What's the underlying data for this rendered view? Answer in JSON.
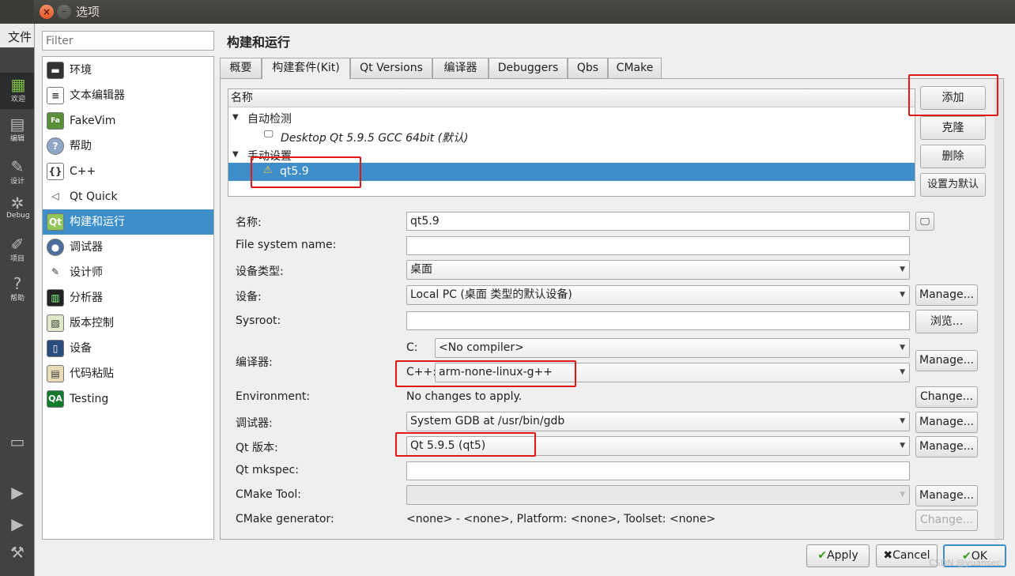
{
  "background": {
    "menu_file": "文件",
    "modes": [
      {
        "label": "欢迎",
        "icon": "grid-icon"
      },
      {
        "label": "编辑",
        "icon": "edit-icon"
      },
      {
        "label": "设计",
        "icon": "design-icon"
      },
      {
        "label": "Debug",
        "icon": "bug-icon"
      },
      {
        "label": "项目",
        "icon": "wrench-icon"
      },
      {
        "label": "帮助",
        "icon": "help-icon"
      }
    ]
  },
  "dialog": {
    "title": "选项",
    "filter_placeholder": "Filter",
    "categories": [
      {
        "label": "环境",
        "icon": "monitor-icon"
      },
      {
        "label": "文本编辑器",
        "icon": "text-editor-icon"
      },
      {
        "label": "FakeVim",
        "icon": "fakevim-icon"
      },
      {
        "label": "帮助",
        "icon": "help-icon"
      },
      {
        "label": "C++",
        "icon": "braces-icon"
      },
      {
        "label": "Qt Quick",
        "icon": "qtquick-icon"
      },
      {
        "label": "构建和运行",
        "icon": "qt-build-icon",
        "selected": true
      },
      {
        "label": "调试器",
        "icon": "debugger-icon"
      },
      {
        "label": "设计师",
        "icon": "designer-icon"
      },
      {
        "label": "分析器",
        "icon": "analyzer-icon"
      },
      {
        "label": "版本控制",
        "icon": "version-control-icon"
      },
      {
        "label": "设备",
        "icon": "device-icon"
      },
      {
        "label": "代码粘贴",
        "icon": "code-paste-icon"
      },
      {
        "label": "Testing",
        "icon": "qa-icon"
      }
    ],
    "page_title": "构建和运行",
    "tabs": [
      {
        "label": "概要"
      },
      {
        "label": "构建套件(Kit)",
        "active": true
      },
      {
        "label": "Qt Versions"
      },
      {
        "label": "编译器"
      },
      {
        "label": "Debuggers"
      },
      {
        "label": "Qbs"
      },
      {
        "label": "CMake"
      }
    ],
    "kit_tree": {
      "header": "名称",
      "group_auto": "自动检测",
      "auto_kit": "Desktop Qt 5.9.5 GCC 64bit (默认)",
      "group_manual": "手动设置",
      "manual_kit": "qt5.9"
    },
    "kit_buttons": {
      "add": "添加",
      "clone": "克隆",
      "remove": "删除",
      "make_default": "设置为默认"
    },
    "form": {
      "name_label": "名称:",
      "name_value": "qt5.9",
      "fsname_label": "File system name:",
      "fsname_value": "",
      "device_type_label": "设备类型:",
      "device_type_value": "桌面",
      "device_label": "设备:",
      "device_value": "Local PC (桌面 类型的默认设备)",
      "sysroot_label": "Sysroot:",
      "sysroot_value": "",
      "compiler_label": "编译器:",
      "c_label": "C:",
      "c_value": "<No compiler>",
      "cpp_label": "C++:",
      "cpp_value": "arm-none-linux-g++",
      "env_label": "Environment:",
      "env_value": "No changes to apply.",
      "debugger_label": "调试器:",
      "debugger_value": "System GDB at /usr/bin/gdb",
      "qtver_label": "Qt 版本:",
      "qtver_value": "Qt 5.9.5 (qt5)",
      "mkspec_label": "Qt mkspec:",
      "mkspec_value": "",
      "cmake_tool_label": "CMake Tool:",
      "cmake_tool_value": "",
      "cmake_gen_label": "CMake generator:",
      "cmake_gen_value": "<none> - <none>, Platform: <none>, Toolset: <none>",
      "manage": "Manage...",
      "browse": "浏览...",
      "change": "Change..."
    },
    "footer": {
      "apply": "Apply",
      "cancel": "Cancel",
      "ok": "OK"
    }
  },
  "watermark": "CSDN @yuansec"
}
